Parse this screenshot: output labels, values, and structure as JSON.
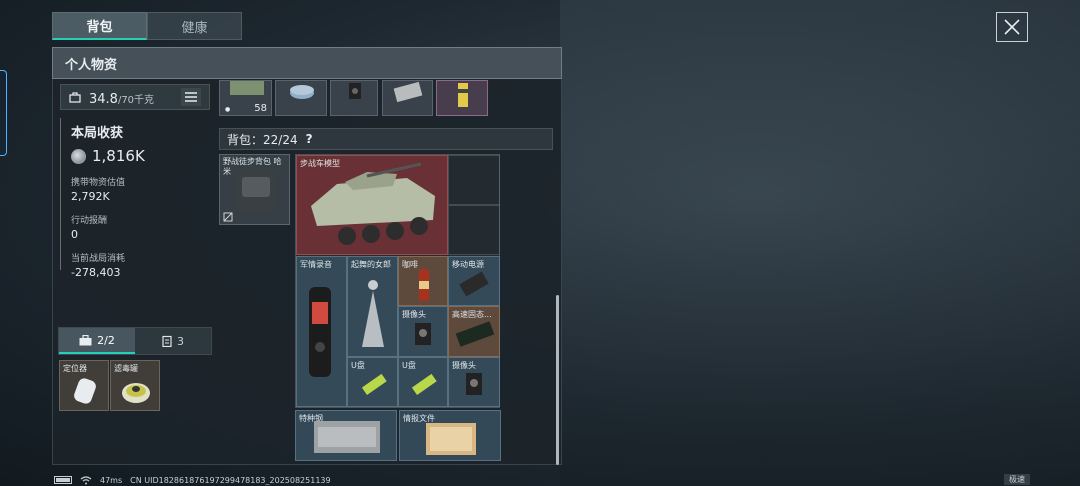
{
  "top_tabs": [
    {
      "label": "背包",
      "active": true
    },
    {
      "label": "健康",
      "active": false
    }
  ],
  "panel": {
    "title": "个人物资"
  },
  "weight": {
    "current": "34.8",
    "max": "/70千克"
  },
  "stats": {
    "title": "本局收获",
    "coin_value": "1,816K",
    "carry_label": "携带物资估值",
    "carry_value": "2,792K",
    "reward_label": "行动报酬",
    "reward_value": "0",
    "cost_label": "当前战局消耗",
    "cost_value": "-278,403"
  },
  "bottom_tabs": [
    {
      "label": "2/2",
      "icon": "toolbox-icon",
      "active": true
    },
    {
      "label": "3",
      "icon": "clipboard-icon",
      "active": false
    }
  ],
  "pouch_items": [
    {
      "label": "定位器"
    },
    {
      "label": "滤毒罐"
    }
  ],
  "top_items": [
    {
      "count": "58"
    }
  ],
  "backpack": {
    "label": "背包：22/24",
    "help": "?",
    "slot_label": "野战徒步背包 哈米"
  },
  "bag_items": [
    {
      "label": "步战车模型"
    },
    {
      "label": "军情录音"
    },
    {
      "label": "起舞的女郎"
    },
    {
      "label": "咖啡"
    },
    {
      "label": "移动电源"
    },
    {
      "label": "摄像头"
    },
    {
      "label": "高速固态..."
    },
    {
      "label": "U盘"
    },
    {
      "label": "U盘"
    },
    {
      "label": "摄像头"
    },
    {
      "label": "特种钢"
    },
    {
      "label": "情报文件"
    }
  ],
  "status": {
    "ping": "47ms",
    "uid": "CN UID18286187619729947818​3_20250825113​9",
    "mode": "极速"
  }
}
